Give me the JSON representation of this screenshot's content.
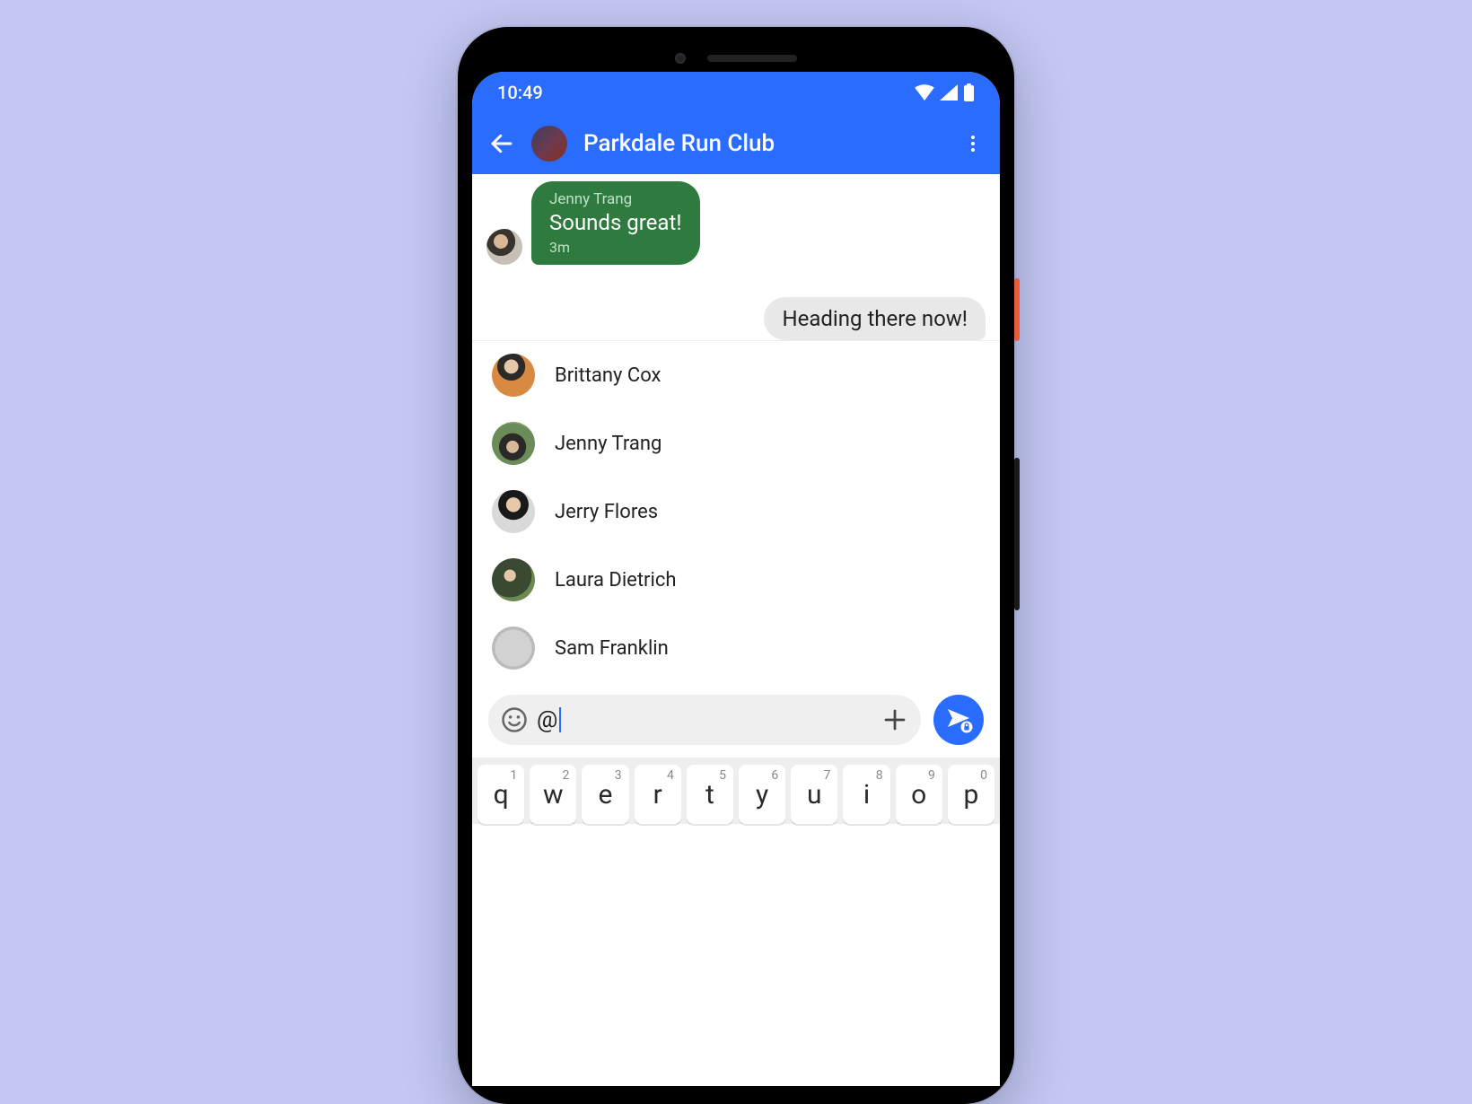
{
  "status": {
    "time": "10:49"
  },
  "header": {
    "title": "Parkdale Run Club"
  },
  "messages": {
    "in": {
      "sender": "Jenny Trang",
      "body": "Sounds great!",
      "time": "3m"
    },
    "out": {
      "body": "Heading there now!"
    }
  },
  "mentions": [
    {
      "name": "Brittany Cox"
    },
    {
      "name": "Jenny Trang"
    },
    {
      "name": "Jerry Flores"
    },
    {
      "name": "Laura Dietrich"
    },
    {
      "name": "Sam Franklin"
    }
  ],
  "composer": {
    "value": "@"
  },
  "keyboard": {
    "row1": [
      {
        "k": "q",
        "s": "1"
      },
      {
        "k": "w",
        "s": "2"
      },
      {
        "k": "e",
        "s": "3"
      },
      {
        "k": "r",
        "s": "4"
      },
      {
        "k": "t",
        "s": "5"
      },
      {
        "k": "y",
        "s": "6"
      },
      {
        "k": "u",
        "s": "7"
      },
      {
        "k": "i",
        "s": "8"
      },
      {
        "k": "o",
        "s": "9"
      },
      {
        "k": "p",
        "s": "0"
      }
    ]
  },
  "colors": {
    "accent": "#2a6cff",
    "bubble_in": "#2f7a3f",
    "bubble_out": "#e8e8e8",
    "page_bg": "#c2c7f3"
  }
}
